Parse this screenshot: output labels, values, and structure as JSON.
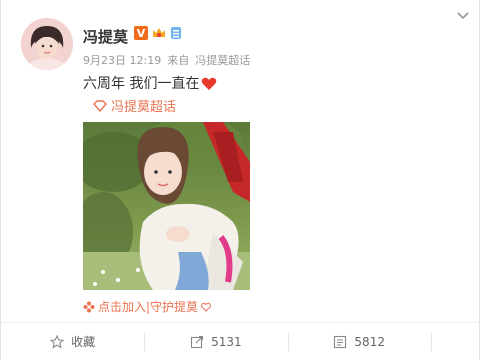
{
  "user": {
    "name": "冯提莫",
    "verified_badge": "V",
    "date": "9月23日 12:19",
    "source_prefix": "来自",
    "source": "冯提莫超话"
  },
  "post": {
    "text": "六周年 我们一直在",
    "heart_emoji": "heart-icon"
  },
  "topic": {
    "label": "冯提莫超话"
  },
  "join": {
    "label": "点击加入|守护提莫"
  },
  "actions": {
    "favorite": "收藏",
    "repost": "5131",
    "comment": "5812"
  },
  "colors": {
    "accent": "#eb7350",
    "verified": "#f26d1b",
    "heart": "#e8392f"
  }
}
